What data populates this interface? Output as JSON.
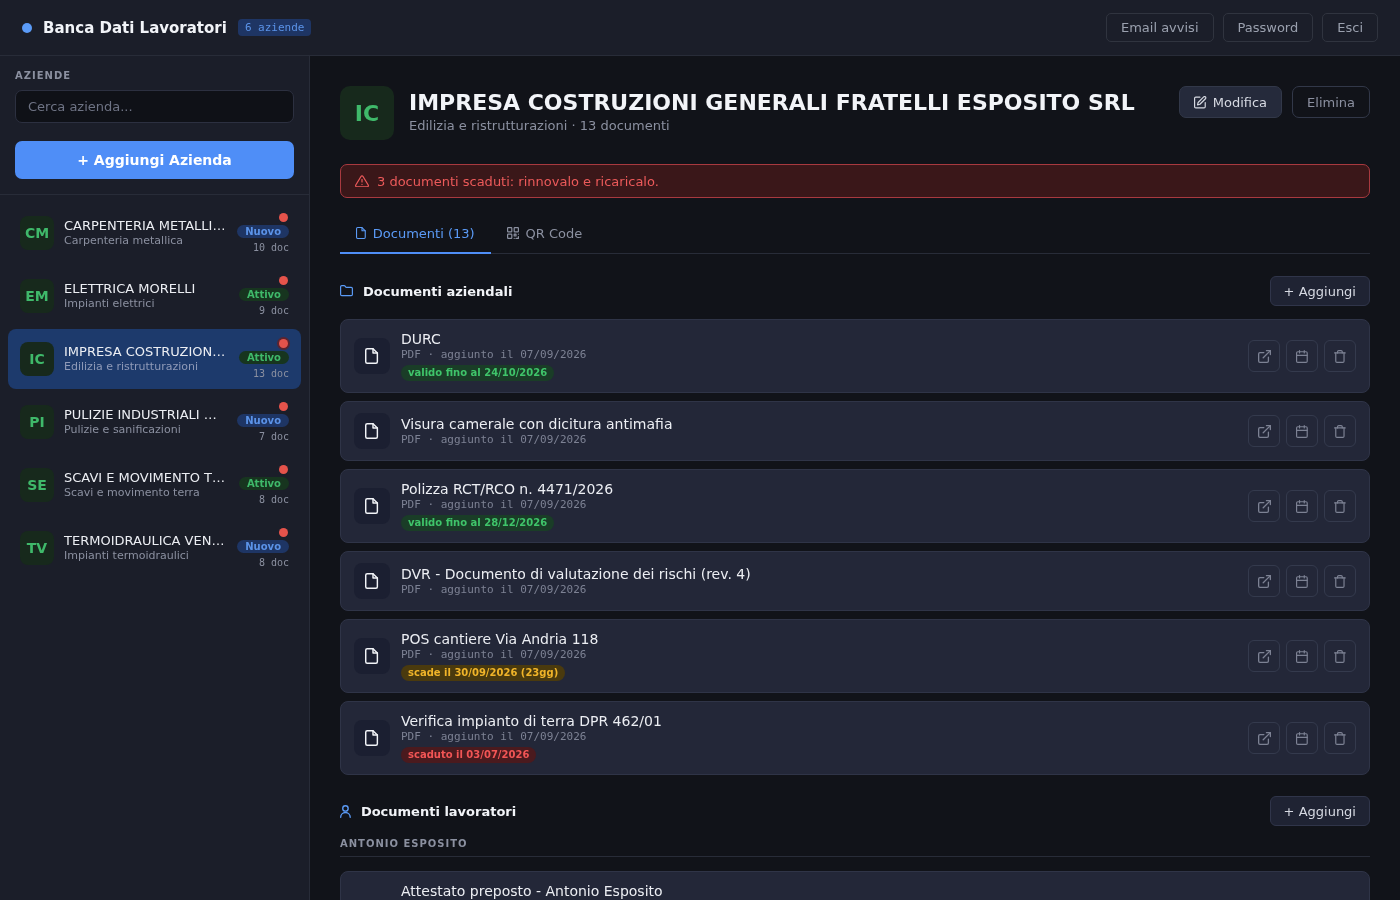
{
  "topbar": {
    "title": "Banca Dati Lavoratori",
    "count_badge": "6 aziende",
    "buttons": [
      "Email avvisi",
      "Password",
      "Esci"
    ]
  },
  "sidebar": {
    "heading": "AZIENDE",
    "search": {
      "placeholder": "Cerca azienda..."
    },
    "add_button": "+ Aggiungi Azienda",
    "companies": [
      {
        "initials": "CM",
        "name": "CARPENTERIA METALLI…",
        "category": "Carpenteria metallica",
        "badge": {
          "text": "Nuovo",
          "kind": "new"
        },
        "alert": true,
        "doc_count": "10 doc",
        "selected": false
      },
      {
        "initials": "EM",
        "name": "ELETTRICA MORELLI",
        "category": "Impianti elettrici",
        "badge": {
          "text": "Attivo",
          "kind": "active"
        },
        "alert": true,
        "doc_count": "9 doc",
        "selected": false
      },
      {
        "initials": "IC",
        "name": "IMPRESA COSTRUZION…",
        "category": "Edilizia e ristrutturazioni",
        "badge": {
          "text": "Attivo",
          "kind": "active"
        },
        "alert": true,
        "doc_count": "13 doc",
        "selected": true
      },
      {
        "initials": "PI",
        "name": "PULIZIE INDUSTRIALI …",
        "category": "Pulizie e sanificazioni",
        "badge": {
          "text": "Nuovo",
          "kind": "new"
        },
        "alert": true,
        "doc_count": "7 doc",
        "selected": false
      },
      {
        "initials": "SE",
        "name": "SCAVI E MOVIMENTO T…",
        "category": "Scavi e movimento terra",
        "badge": {
          "text": "Attivo",
          "kind": "active"
        },
        "alert": true,
        "doc_count": "8 doc",
        "selected": false
      },
      {
        "initials": "TV",
        "name": "TERMOIDRAULICA VEN…",
        "category": "Impianti termoidraulici",
        "badge": {
          "text": "Nuovo",
          "kind": "new"
        },
        "alert": true,
        "doc_count": "8 doc",
        "selected": false
      }
    ]
  },
  "company": {
    "initials": "IC",
    "name": "IMPRESA COSTRUZIONI GENERALI FRATELLI ESPOSITO SRL",
    "subtitle": "Edilizia e ristrutturazioni · 13 documenti",
    "buttons": [
      {
        "label": "Modifica",
        "kind": "edit"
      },
      {
        "label": "Elimina",
        "kind": "delete"
      }
    ]
  },
  "warning_banner": {
    "text": "3 documenti scaduti: rinnovalo e ricaricalo."
  },
  "tabs": [
    {
      "label": "Documenti (13)",
      "kind": "documents",
      "selected": true
    },
    {
      "label": "QR Code",
      "kind": "qr",
      "selected": false
    }
  ],
  "sections": [
    {
      "title": "Documenti aziendali",
      "kind": "company",
      "add_button": "+ Aggiungi",
      "groups": [
        {
          "documents": [
            {
              "title": "DURC",
              "meta": "PDF · aggiunto il 07/09/2026",
              "expiry": {
                "text": "valido fino al 24/10/2026",
                "kind": "valid"
              }
            },
            {
              "title": "Visura camerale con dicitura antimafia",
              "meta": "PDF · aggiunto il 07/09/2026"
            },
            {
              "title": "Polizza RCT/RCO n. 4471/2026",
              "meta": "PDF · aggiunto il 07/09/2026",
              "expiry": {
                "text": "valido fino al 28/12/2026",
                "kind": "valid"
              }
            },
            {
              "title": "DVR - Documento di valutazione dei rischi (rev. 4)",
              "meta": "PDF · aggiunto il 07/09/2026"
            },
            {
              "title": "POS cantiere Via Andria 118",
              "meta": "PDF · aggiunto il 07/09/2026",
              "expiry": {
                "text": "scade il 30/09/2026 (23gg)",
                "kind": "expiring"
              }
            },
            {
              "title": "Verifica impianto di terra DPR 462/01",
              "meta": "PDF · aggiunto il 07/09/2026",
              "expiry": {
                "text": "scaduto il 03/07/2026",
                "kind": "expired"
              }
            }
          ]
        }
      ]
    },
    {
      "title": "Documenti lavoratori",
      "kind": "workers",
      "add_button": "+ Aggiungi",
      "groups": [
        {
          "heading": "ANTONIO ESPOSITO",
          "documents": [
            {
              "title": "Attestato preposto - Antonio Esposito"
            }
          ]
        }
      ]
    }
  ]
}
